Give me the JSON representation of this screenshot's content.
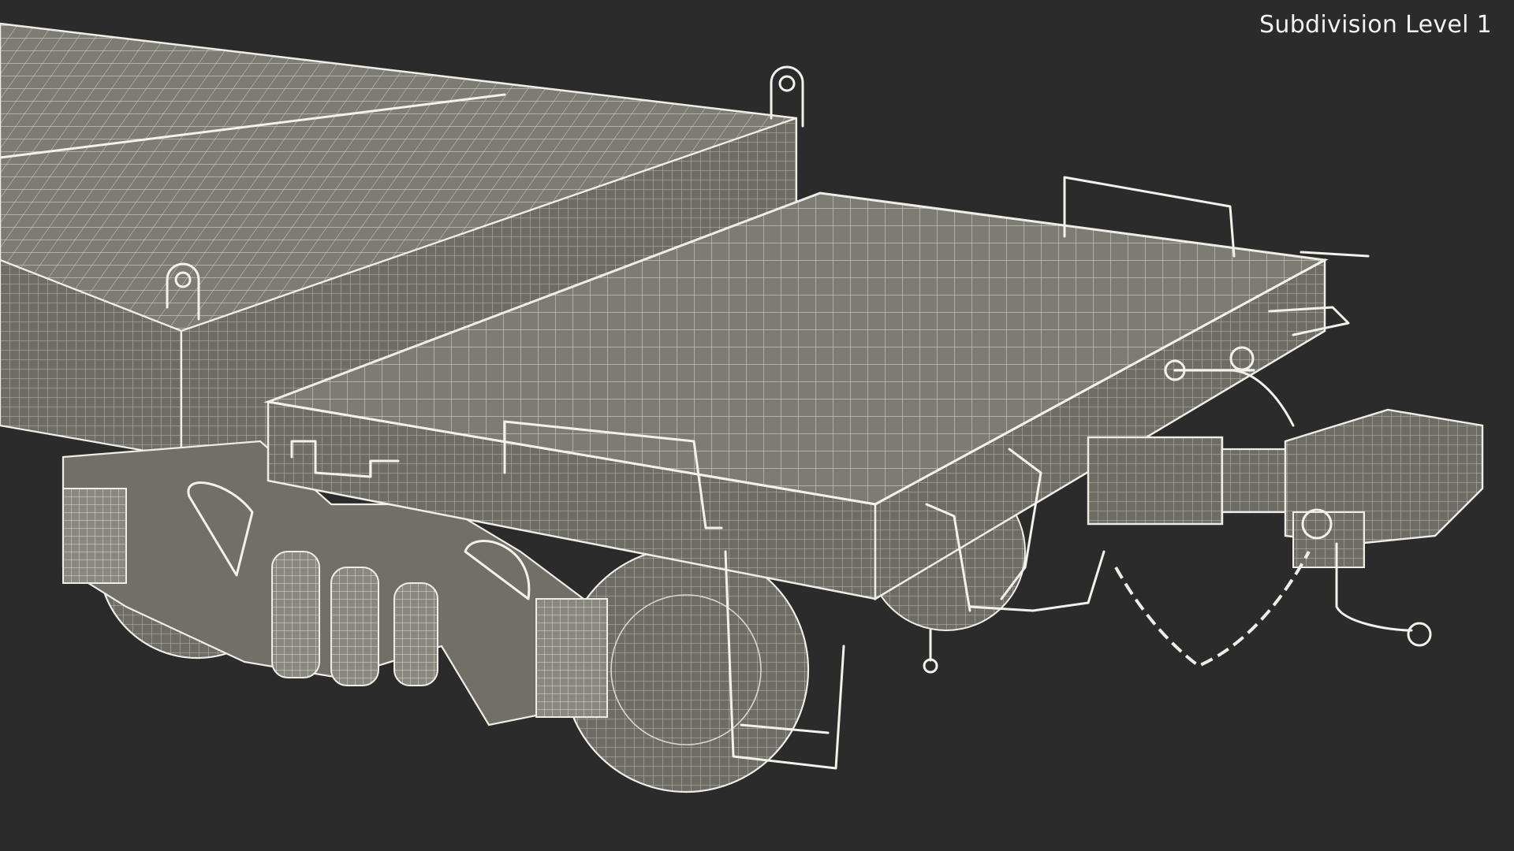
{
  "viewport": {
    "overlay_label": "Subdivision Level 1",
    "background_color": "#2b2b2b",
    "wire_color": "#efeee6",
    "surface_color": "#7c7b72"
  }
}
